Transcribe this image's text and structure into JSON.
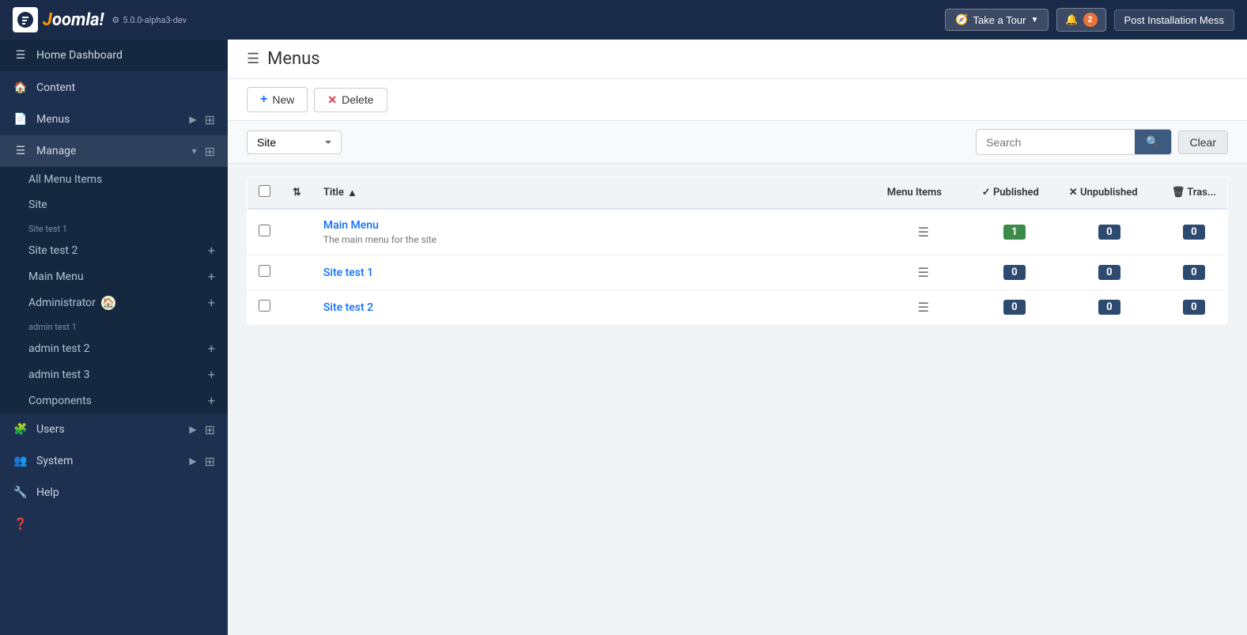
{
  "topbar": {
    "logo_text": "Joomla!",
    "version": "5.0.0-alpha3-dev",
    "take_a_tour_label": "Take a Tour",
    "notifications_count": "2",
    "post_install_label": "Post Installation Mess"
  },
  "sidebar": {
    "toggle_menu_label": "Toggle Menu",
    "items": [
      {
        "id": "home-dashboard",
        "label": "Home Dashboard",
        "icon": "home"
      },
      {
        "id": "content",
        "label": "Content",
        "icon": "file",
        "has_arrow": true,
        "has_grid": true
      },
      {
        "id": "menus",
        "label": "Menus",
        "icon": "list",
        "has_arrow": true,
        "has_grid": true,
        "active": true
      },
      {
        "id": "manage",
        "label": "Manage",
        "sub": true
      },
      {
        "id": "all-menu-items",
        "label": "All Menu Items",
        "sub": true
      },
      {
        "id": "site-section",
        "label": "Site",
        "section": true
      },
      {
        "id": "site-test-1",
        "label": "Site test 1",
        "child": true
      },
      {
        "id": "site-test-2",
        "label": "Site test 2",
        "child": true
      },
      {
        "id": "main-menu",
        "label": "Main Menu",
        "child": true,
        "has_home": true
      },
      {
        "id": "admin-section",
        "label": "Administrator",
        "section": true
      },
      {
        "id": "admin-test-1",
        "label": "admin test 1",
        "child": true
      },
      {
        "id": "admin-test-2",
        "label": "admin test 2",
        "child": true
      },
      {
        "id": "admin-test-3",
        "label": "admin test 3",
        "child": true
      },
      {
        "id": "components",
        "label": "Components",
        "icon": "puzzle",
        "has_arrow": true,
        "has_grid": true
      },
      {
        "id": "users",
        "label": "Users",
        "icon": "users",
        "has_arrow": true,
        "has_grid": true
      },
      {
        "id": "system",
        "label": "System",
        "icon": "wrench"
      },
      {
        "id": "help",
        "label": "Help",
        "icon": "question"
      }
    ]
  },
  "page": {
    "title": "Menus",
    "toolbar": {
      "new_label": "New",
      "delete_label": "Delete"
    },
    "filter": {
      "site_option": "Site",
      "search_placeholder": "Search",
      "clear_label": "Clear"
    },
    "table": {
      "columns": {
        "title": "Title",
        "menu_items": "Menu Items",
        "published": "Published",
        "unpublished": "Unpublished",
        "trash": "Tras..."
      },
      "rows": [
        {
          "id": "main-menu",
          "title": "Main Menu",
          "description": "The main menu for the site",
          "published": "1",
          "unpublished": "0",
          "trash": "0",
          "published_color": "green"
        },
        {
          "id": "site-test-1",
          "title": "Site test 1",
          "description": "",
          "published": "0",
          "unpublished": "0",
          "trash": "0",
          "published_color": "navy"
        },
        {
          "id": "site-test-2",
          "title": "Site test 2",
          "description": "",
          "published": "0",
          "unpublished": "0",
          "trash": "0",
          "published_color": "navy"
        }
      ]
    }
  }
}
